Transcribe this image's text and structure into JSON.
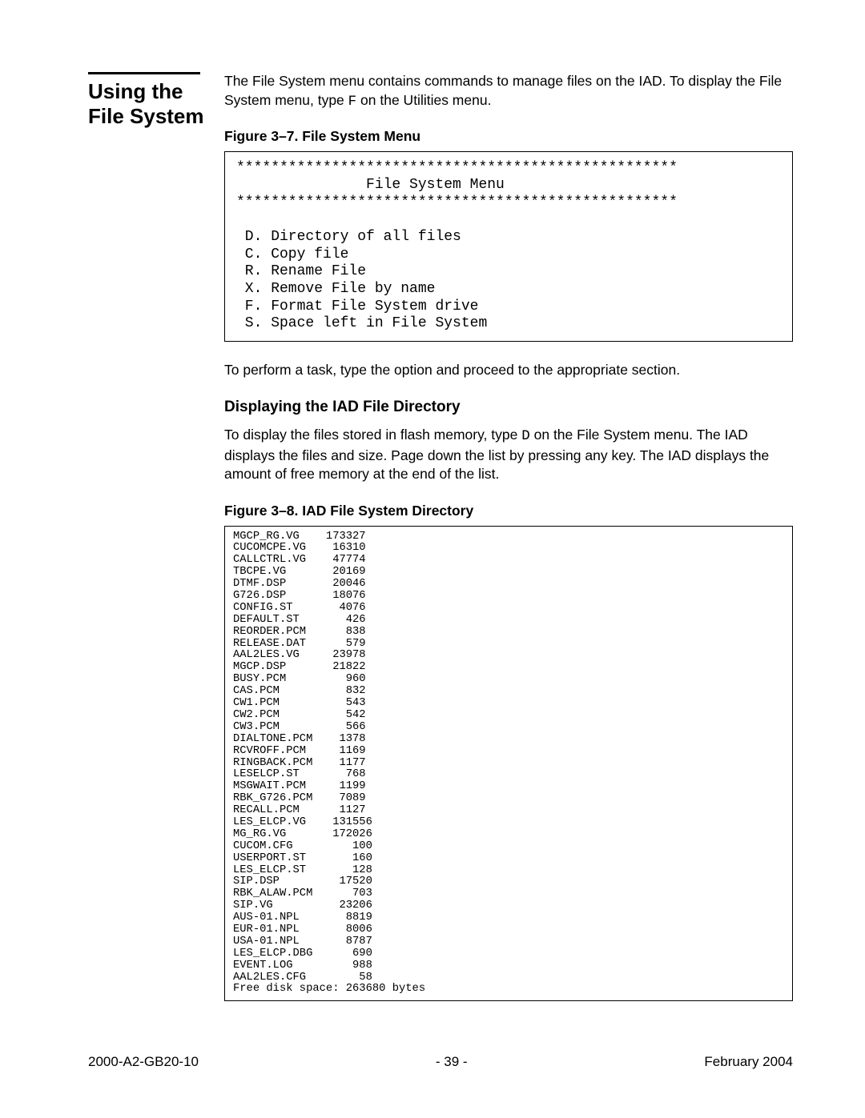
{
  "sidebar_title": "Using the File System",
  "intro_part1": "The File System menu contains commands to manage files on the IAD. To display the File System menu, type ",
  "intro_code": "F",
  "intro_part2": " on the Utilities menu.",
  "figure7_caption": "Figure 3–7.  File System Menu",
  "figure7_lines": {
    "l0": "***************************************************",
    "l1": "               File System Menu",
    "l2": "***************************************************",
    "l3": "",
    "l4": " D. Directory of all files",
    "l5": " C. Copy file",
    "l6": " R. Rename File",
    "l7": " X. Remove File by name",
    "l8": " F. Format File System drive",
    "l9": " S. Space left in File System"
  },
  "after_fig7": "To perform a task, type the option and proceed to the appropriate section.",
  "subheading": "Displaying the IAD File Directory",
  "para2_part1": "To display the files stored in flash memory, type ",
  "para2_code": "D",
  "para2_part2": " on the File System menu. The IAD displays the files and size. Page down the list by pressing any key. The IAD displays the amount of free memory at the end of the list.",
  "figure8_caption": "Figure 3–8.  IAD File System Directory",
  "figure8_lines": {
    "l0": "MGCP_RG.VG    173327",
    "l1": "CUCOMCPE.VG    16310",
    "l2": "CALLCTRL.VG    47774",
    "l3": "TBCPE.VG       20169",
    "l4": "DTMF.DSP       20046",
    "l5": "G726.DSP       18076",
    "l6": "CONFIG.ST       4076",
    "l7": "DEFAULT.ST       426",
    "l8": "REORDER.PCM      838",
    "l9": "RELEASE.DAT      579",
    "l10": "AAL2LES.VG     23978",
    "l11": "MGCP.DSP       21822",
    "l12": "BUSY.PCM         960",
    "l13": "CAS.PCM          832",
    "l14": "CW1.PCM          543",
    "l15": "CW2.PCM          542",
    "l16": "CW3.PCM          566",
    "l17": "DIALTONE.PCM    1378",
    "l18": "RCVROFF.PCM     1169",
    "l19": "RINGBACK.PCM    1177",
    "l20": "LESELCP.ST       768",
    "l21": "MSGWAIT.PCM     1199",
    "l22": "RBK_G726.PCM    7089",
    "l23": "RECALL.PCM      1127",
    "l24": "LES_ELCP.VG    131556",
    "l25": "MG_RG.VG       172026",
    "l26": "CUCOM.CFG         100",
    "l27": "USERPORT.ST       160",
    "l28": "LES_ELCP.ST       128",
    "l29": "SIP.DSP         17520",
    "l30": "RBK_ALAW.PCM      703",
    "l31": "SIP.VG          23206",
    "l32": "AUS-01.NPL       8819",
    "l33": "EUR-01.NPL       8006",
    "l34": "USA-01.NPL       8787",
    "l35": "LES_ELCP.DBG      690",
    "l36": "EVENT.LOG         988",
    "l37": "AAL2LES.CFG        58",
    "l38": "Free disk space: 263680 bytes"
  },
  "footer_left": "2000-A2-GB20-10",
  "footer_center": "- 39 -",
  "footer_right": "February 2004"
}
